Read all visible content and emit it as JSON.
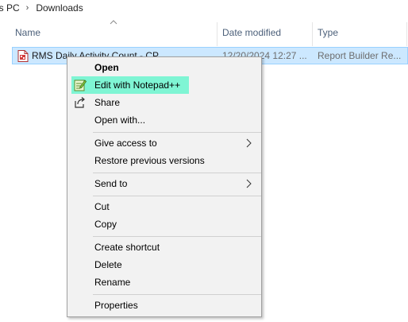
{
  "breadcrumb": {
    "items": [
      "is PC",
      "Downloads"
    ],
    "separator": "›"
  },
  "columns": {
    "name": "Name",
    "date_modified": "Date modified",
    "type": "Type"
  },
  "file": {
    "name": "RMS Daily Activity Count - CP",
    "date_modified": "12/20/2024 12:27 ...",
    "type": "Report Builder Re...",
    "icon": "report-file-icon"
  },
  "context_menu": {
    "items": [
      {
        "label": "Open",
        "bold": true
      },
      {
        "label": "Edit with Notepad++",
        "icon": "notepad-plus-plus-icon",
        "highlighted": true
      },
      {
        "label": "Share",
        "icon": "share-icon"
      },
      {
        "label": "Open with..."
      },
      {
        "label": "Give access to",
        "submenu": true
      },
      {
        "label": "Restore previous versions"
      },
      {
        "label": "Send to",
        "submenu": true
      },
      {
        "label": "Cut"
      },
      {
        "label": "Copy"
      },
      {
        "label": "Create shortcut"
      },
      {
        "label": "Delete"
      },
      {
        "label": "Rename"
      },
      {
        "label": "Properties"
      }
    ]
  },
  "colors": {
    "selection_bg": "#cce8ff",
    "highlight": "#7ff5d4",
    "menu_bg": "#f2f2f2"
  }
}
